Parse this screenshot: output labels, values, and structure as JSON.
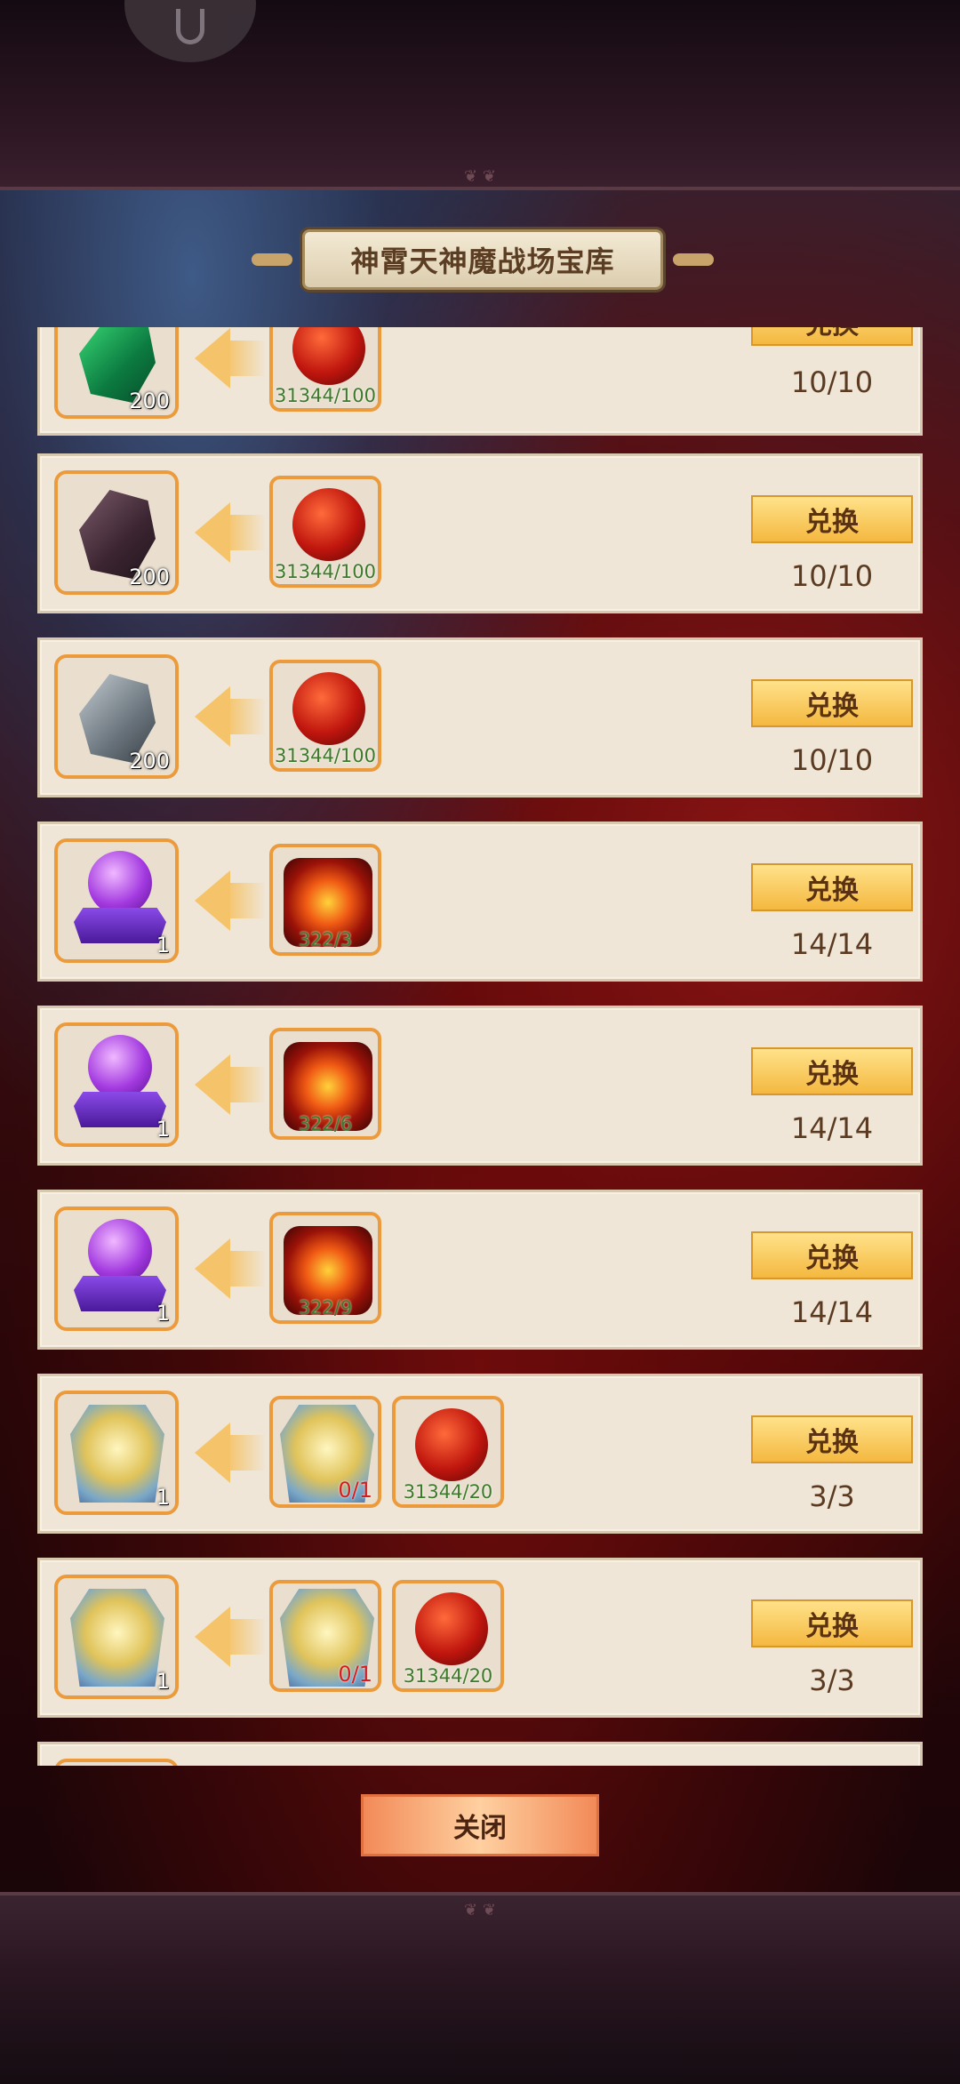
{
  "title": "神霄天神魔战场宝库",
  "exchange_label": "兑换",
  "close_label": "关闭",
  "rows": [
    {
      "reward_icon": "green-gem-icon",
      "reward_qty": "200",
      "costs": [
        {
          "icon": "red-orb-icon",
          "need": "31344/100"
        }
      ],
      "count": "10/10"
    },
    {
      "reward_icon": "dark-gem-icon",
      "reward_qty": "200",
      "costs": [
        {
          "icon": "red-orb-icon",
          "need": "31344/100"
        }
      ],
      "count": "10/10"
    },
    {
      "reward_icon": "grey-gem-icon",
      "reward_qty": "200",
      "costs": [
        {
          "icon": "red-orb-icon",
          "need": "31344/100"
        }
      ],
      "count": "10/10"
    },
    {
      "reward_icon": "purple-orb-stand-icon",
      "reward_qty": "1",
      "costs": [
        {
          "icon": "fire-chest-icon",
          "need": "322/3"
        }
      ],
      "count": "14/14"
    },
    {
      "reward_icon": "purple-orb-stand-icon",
      "reward_qty": "1",
      "costs": [
        {
          "icon": "fire-chest-icon",
          "need": "322/6"
        }
      ],
      "count": "14/14"
    },
    {
      "reward_icon": "purple-orb-stand-icon",
      "reward_qty": "1",
      "costs": [
        {
          "icon": "fire-chest-icon",
          "need": "322/9"
        }
      ],
      "count": "14/14"
    },
    {
      "reward_icon": "golden-armor-icon",
      "reward_qty": "1",
      "costs": [
        {
          "icon": "golden-armor-icon",
          "need": "0/1"
        },
        {
          "icon": "red-orb-icon",
          "need": "31344/20"
        }
      ],
      "count": "3/3"
    },
    {
      "reward_icon": "golden-armor-icon",
      "reward_qty": "1",
      "costs": [
        {
          "icon": "golden-armor-icon",
          "need": "0/1"
        },
        {
          "icon": "red-orb-icon",
          "need": "31344/20"
        }
      ],
      "count": "3/3"
    }
  ]
}
